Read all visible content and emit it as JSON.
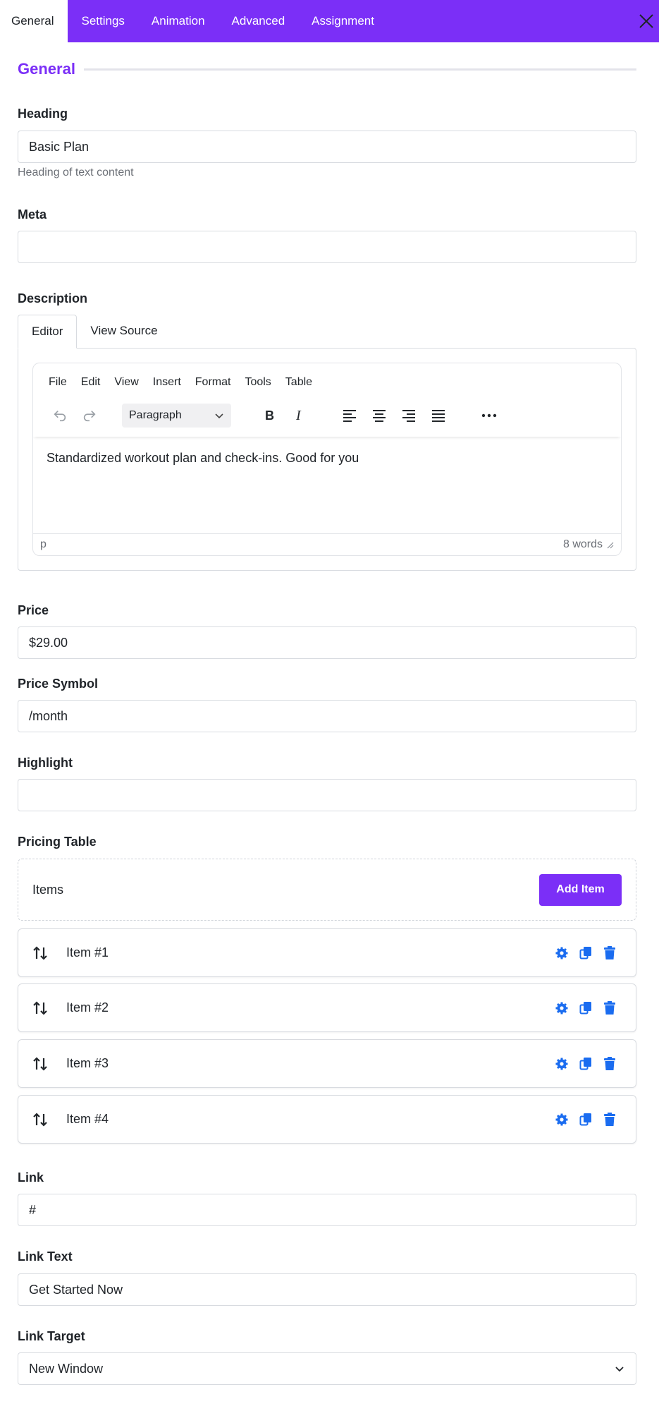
{
  "tabs": [
    "General",
    "Settings",
    "Animation",
    "Advanced",
    "Assignment"
  ],
  "section_title": "General",
  "heading": {
    "label": "Heading",
    "value": "Basic Plan",
    "help": "Heading of text content"
  },
  "meta": {
    "label": "Meta",
    "value": ""
  },
  "description": {
    "label": "Description",
    "tabs": [
      "Editor",
      "View Source"
    ],
    "menu": [
      "File",
      "Edit",
      "View",
      "Insert",
      "Format",
      "Tools",
      "Table"
    ],
    "block_format": "Paragraph",
    "content": "Standardized workout plan and check-ins.  Good for you",
    "path": "p",
    "word_count": "8 words"
  },
  "price": {
    "label": "Price",
    "value": "$29.00"
  },
  "price_symbol": {
    "label": "Price Symbol",
    "value": "/month"
  },
  "highlight": {
    "label": "Highlight",
    "value": ""
  },
  "pricing_table": {
    "label": "Pricing Table",
    "items_title": "Items",
    "add_button": "Add Item",
    "items": [
      "Item #1",
      "Item #2",
      "Item #3",
      "Item #4"
    ]
  },
  "link": {
    "label": "Link",
    "value": "#"
  },
  "link_text": {
    "label": "Link Text",
    "value": "Get Started Now"
  },
  "link_target": {
    "label": "Link Target",
    "value": "New Window"
  },
  "colors": {
    "accent": "#7b2ff7",
    "icon_blue": "#1a6cf0"
  }
}
